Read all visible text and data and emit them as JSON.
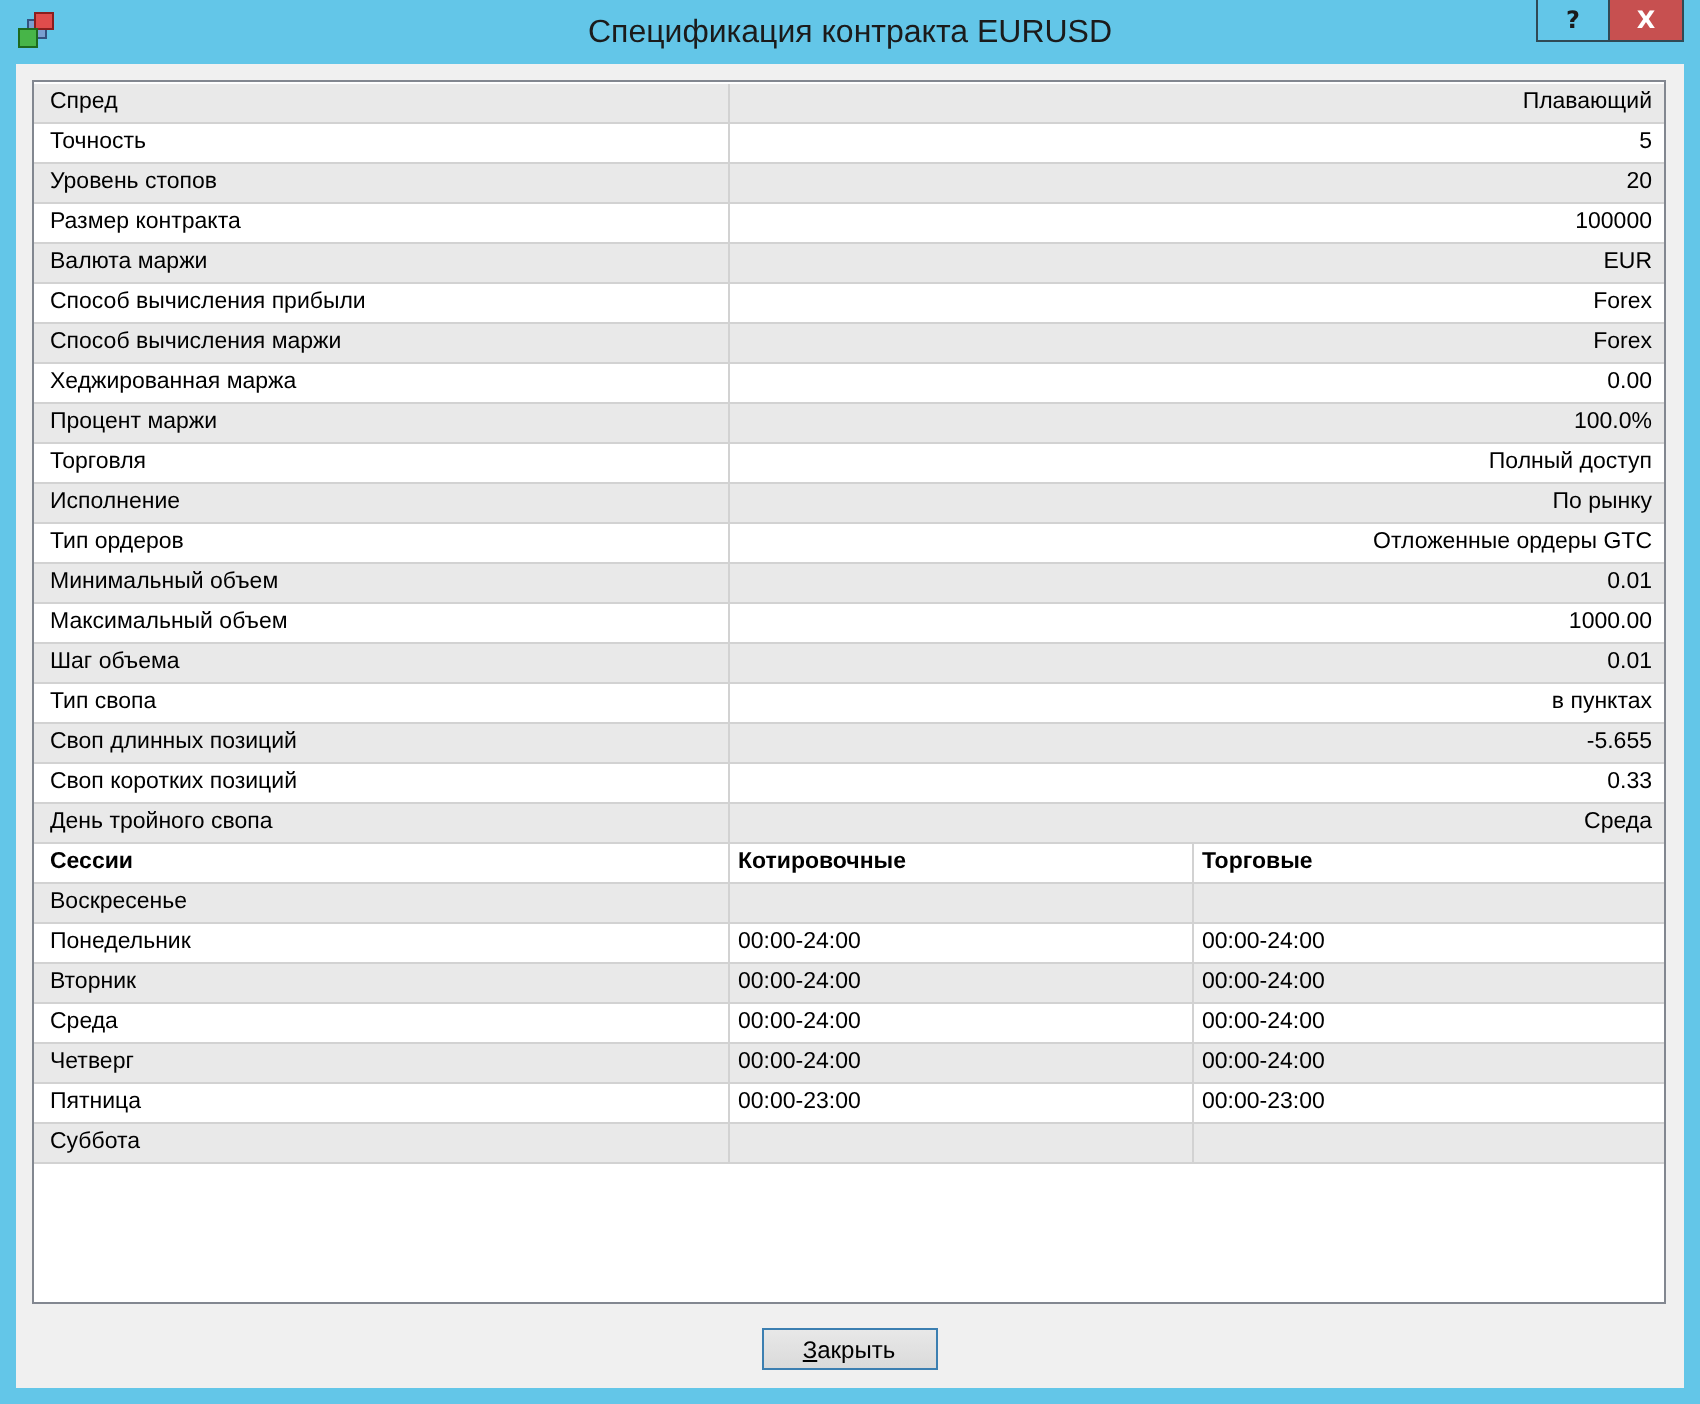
{
  "window": {
    "title": "Спецификация контракта EURUSD",
    "buttons": [
      {
        "kind": "help",
        "label": "?"
      },
      {
        "kind": "close",
        "label": "X"
      }
    ]
  },
  "specs": [
    {
      "name": "Спред",
      "value": "Плавающий"
    },
    {
      "name": "Точность",
      "value": "5"
    },
    {
      "name": "Уровень стопов",
      "value": "20"
    },
    {
      "name": "Размер контракта",
      "value": "100000"
    },
    {
      "name": "Валюта маржи",
      "value": "EUR"
    },
    {
      "name": "Способ вычисления прибыли",
      "value": "Forex"
    },
    {
      "name": "Способ вычисления маржи",
      "value": "Forex"
    },
    {
      "name": "Хеджированная маржа",
      "value": "0.00"
    },
    {
      "name": "Процент маржи",
      "value": "100.0%"
    },
    {
      "name": "Торговля",
      "value": "Полный доступ"
    },
    {
      "name": "Исполнение",
      "value": "По рынку"
    },
    {
      "name": "Тип ордеров",
      "value": "Отложенные ордеры GTC"
    },
    {
      "name": "Минимальный объем",
      "value": "0.01"
    },
    {
      "name": "Максимальный объем",
      "value": "1000.00"
    },
    {
      "name": "Шаг объема",
      "value": "0.01"
    },
    {
      "name": "Тип свопа",
      "value": "в пунктах"
    },
    {
      "name": "Своп длинных позиций",
      "value": "-5.655"
    },
    {
      "name": "Своп коротких позиций",
      "value": "0.33"
    },
    {
      "name": "День тройного свопа",
      "value": "Среда"
    }
  ],
  "sessions": {
    "columns": [
      "Сессии",
      "Котировочные",
      "Торговые"
    ],
    "rows": [
      {
        "cells": [
          "Воскресенье"
        ]
      },
      {
        "cells": [
          "Понедельник",
          "00:00-24:00",
          "00:00-24:00"
        ]
      },
      {
        "cells": [
          "Вторник",
          "00:00-24:00",
          "00:00-24:00"
        ]
      },
      {
        "cells": [
          "Среда",
          "00:00-24:00",
          "00:00-24:00"
        ]
      },
      {
        "cells": [
          "Четверг",
          "00:00-24:00",
          "00:00-24:00"
        ]
      },
      {
        "cells": [
          "Пятница",
          "00:00-23:00",
          "00:00-23:00"
        ]
      },
      {
        "cells": [
          "Суббота"
        ]
      }
    ]
  },
  "close_button": {
    "label": "Закрыть"
  }
}
